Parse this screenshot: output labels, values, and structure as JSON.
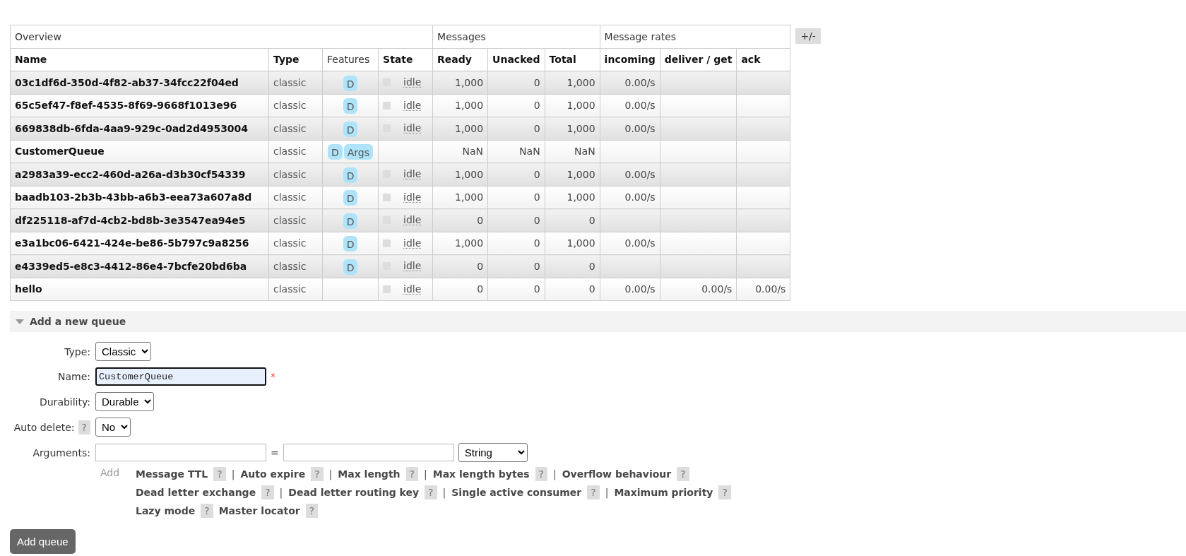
{
  "table": {
    "column_groups": [
      {
        "label": "Overview",
        "columns": [
          {
            "label": "Name",
            "sortable": true
          },
          {
            "label": "Type",
            "sortable": true
          },
          {
            "label": "Features",
            "sortable": false
          },
          {
            "label": "State",
            "sortable": true
          }
        ]
      },
      {
        "label": "Messages",
        "columns": [
          {
            "label": "Ready",
            "sortable": true
          },
          {
            "label": "Unacked",
            "sortable": true
          },
          {
            "label": "Total",
            "sortable": true
          }
        ]
      },
      {
        "label": "Message rates",
        "columns": [
          {
            "label": "incoming",
            "sortable": true
          },
          {
            "label": "deliver / get",
            "sortable": true
          },
          {
            "label": "ack",
            "sortable": true
          }
        ]
      }
    ],
    "toggle_columns": "+/-",
    "rows": [
      {
        "name": "03c1df6d-350d-4f82-ab37-34fcc22f04ed",
        "type": "classic",
        "features": [
          "D"
        ],
        "state": "idle",
        "ready": "1,000",
        "unacked": "0",
        "total": "1,000",
        "incoming": "0.00/s"
      },
      {
        "name": "65c5ef47-f8ef-4535-8f69-9668f1013e96",
        "type": "classic",
        "features": [
          "D"
        ],
        "state": "idle",
        "ready": "1,000",
        "unacked": "0",
        "total": "1,000",
        "incoming": "0.00/s"
      },
      {
        "name": "669838db-6fda-4aa9-929c-0ad2d4953004",
        "type": "classic",
        "features": [
          "D"
        ],
        "state": "idle",
        "ready": "1,000",
        "unacked": "0",
        "total": "1,000",
        "incoming": "0.00/s"
      },
      {
        "name": "CustomerQueue",
        "type": "classic",
        "features": [
          "D",
          "Args"
        ],
        "ready": "NaN",
        "unacked": "NaN",
        "total": "NaN"
      },
      {
        "name": "a2983a39-ecc2-460d-a26a-d3b30cf54339",
        "type": "classic",
        "features": [
          "D"
        ],
        "state": "idle",
        "ready": "1,000",
        "unacked": "0",
        "total": "1,000",
        "incoming": "0.00/s"
      },
      {
        "name": "baadb103-2b3b-43bb-a6b3-eea73a607a8d",
        "type": "classic",
        "features": [
          "D"
        ],
        "state": "idle",
        "ready": "1,000",
        "unacked": "0",
        "total": "1,000",
        "incoming": "0.00/s"
      },
      {
        "name": "df225118-af7d-4cb2-bd8b-3e3547ea94e5",
        "type": "classic",
        "features": [
          "D"
        ],
        "state": "idle",
        "ready": "0",
        "unacked": "0",
        "total": "0"
      },
      {
        "name": "e3a1bc06-6421-424e-be86-5b797c9a8256",
        "type": "classic",
        "features": [
          "D"
        ],
        "state": "idle",
        "ready": "1,000",
        "unacked": "0",
        "total": "1,000",
        "incoming": "0.00/s"
      },
      {
        "name": "e4339ed5-e8c3-4412-86e4-7bcfe20bd6ba",
        "type": "classic",
        "features": [
          "D"
        ],
        "state": "idle",
        "ready": "0",
        "unacked": "0",
        "total": "0"
      },
      {
        "name": "hello",
        "type": "classic",
        "features": [],
        "state": "idle",
        "ready": "0",
        "unacked": "0",
        "total": "0",
        "incoming": "0.00/s",
        "deliver_get": "0.00/s",
        "ack": "0.00/s"
      }
    ]
  },
  "add_queue": {
    "title": "Add a new queue",
    "expanded": true,
    "fields": [
      {
        "kind": "select",
        "label": "Type:",
        "value": "Classic"
      },
      {
        "kind": "text",
        "label": "Name:",
        "value": "CustomerQueue",
        "required": "*"
      },
      {
        "kind": "select",
        "label": "Durability:",
        "value": "Durable"
      },
      {
        "kind": "select",
        "label": "Auto delete:",
        "help": "?",
        "value": "No"
      },
      {
        "kind": "arguments",
        "label": "Arguments:",
        "equals": "=",
        "value_type": "String",
        "add_label": "Add",
        "shortcuts": [
          [
            {
              "label": "Message TTL",
              "help": "?",
              "separator": "|"
            },
            {
              "label": "Auto expire",
              "help": "?",
              "separator": "|"
            },
            {
              "label": "Max length",
              "help": "?",
              "separator": "|"
            },
            {
              "label": "Max length bytes",
              "help": "?",
              "separator": "|"
            },
            {
              "label": "Overflow behaviour",
              "help": "?"
            }
          ],
          [
            {
              "label": "Dead letter exchange",
              "help": "?",
              "separator": "|"
            },
            {
              "label": "Dead letter routing key",
              "help": "?",
              "separator": "|"
            },
            {
              "label": "Single active consumer",
              "help": "?",
              "separator": "|"
            },
            {
              "label": "Maximum priority",
              "help": "?"
            }
          ],
          [
            {
              "label": "Lazy mode",
              "help": "?"
            },
            {
              "label": "Master locator",
              "help": "?"
            }
          ]
        ]
      }
    ],
    "submit": "Add queue"
  }
}
